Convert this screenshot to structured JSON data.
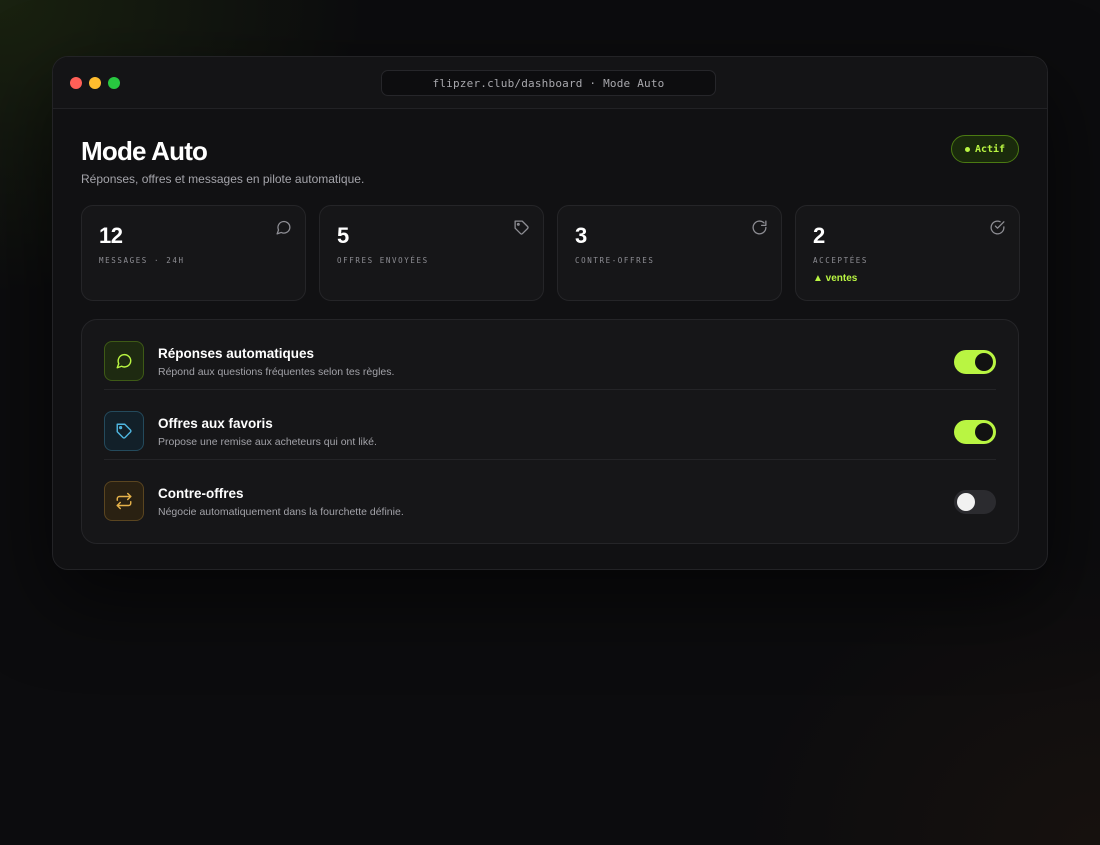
{
  "window": {
    "url": "flipzer.club/dashboard · Mode Auto"
  },
  "page": {
    "title": "Mode Auto",
    "subtitle": "Réponses, offres et messages en pilote automatique.",
    "status": "Actif"
  },
  "stats": [
    {
      "value": "12",
      "label": "MESSAGES · 24H",
      "icon": "chat-bubble-icon"
    },
    {
      "value": "5",
      "label": "OFFRES ENVOYÉES",
      "icon": "tag-icon"
    },
    {
      "value": "3",
      "label": "CONTRE-OFFRES",
      "icon": "refresh-icon"
    },
    {
      "value": "2",
      "label": "ACCEPTÉES",
      "trend": "▲ ventes",
      "icon": "check-circle-icon"
    }
  ],
  "features": [
    {
      "title": "Réponses automatiques",
      "description": "Répond aux questions fréquentes selon tes règles.",
      "enabled": true,
      "icon": "chat-bubble-icon",
      "accent": "#b9f542"
    },
    {
      "title": "Offres aux favoris",
      "description": "Propose une remise aux acheteurs qui ont liké.",
      "enabled": true,
      "icon": "tag-icon",
      "accent": "#4fb6e0"
    },
    {
      "title": "Contre-offres",
      "description": "Négocie automatiquement dans la fourchette définie.",
      "enabled": false,
      "icon": "swap-arrows-icon",
      "accent": "#e6b24a"
    }
  ],
  "colors": {
    "accent": "#b9f542",
    "background": "#0c0c0e",
    "card": "#161618"
  }
}
